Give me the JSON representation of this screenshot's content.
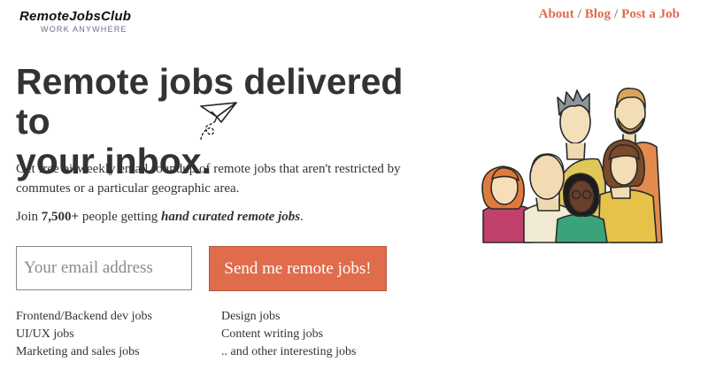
{
  "logo": {
    "name": "RemoteJobsClub",
    "tagline": "WORK ANYWHERE"
  },
  "nav": {
    "about": "About",
    "blog": "Blog",
    "post_job": "Post a Job",
    "separator": "/"
  },
  "headline": {
    "line1": "Remote jobs delivered to",
    "line2": "your inbox."
  },
  "description": "Get free bi-weekly email roundup of remote jobs that aren't restricted by commutes or a particular geographic area.",
  "join": {
    "prefix": "Join ",
    "count": "7,500+",
    "middle": " people getting ",
    "emphasis": "hand curated remote jobs",
    "suffix": "."
  },
  "form": {
    "email_placeholder": "Your email address",
    "submit_label": "Send me remote jobs!"
  },
  "categories": [
    "Frontend/Backend dev jobs",
    "Design jobs",
    "UI/UX jobs",
    "Content writing jobs",
    "Marketing and sales jobs",
    ".. and other interesting jobs"
  ],
  "colors": {
    "accent": "#e06c4c",
    "text": "#333333",
    "tagline": "#6a6f8a"
  },
  "icons": {
    "plane": "paper-plane-icon",
    "illustration": "people-group-illustration"
  }
}
